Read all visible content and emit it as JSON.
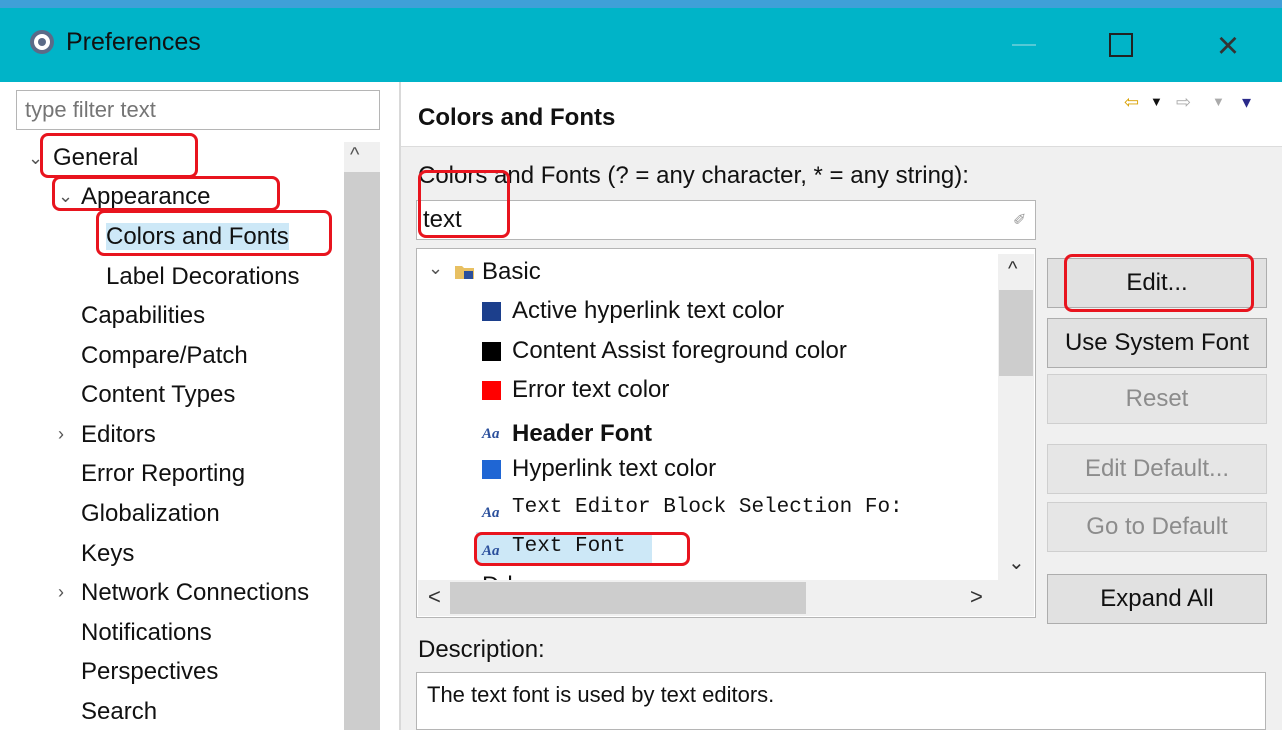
{
  "window": {
    "title": "Preferences",
    "minimize_glyph": "—",
    "maximize_glyph": "",
    "close_glyph": "×",
    "icon": "gear-icon"
  },
  "left": {
    "filter_placeholder": "type filter text",
    "tree": [
      {
        "label": "General",
        "twisty": "⌄"
      },
      {
        "label": "Appearance",
        "twisty": "⌄"
      },
      {
        "label": "Colors and Fonts",
        "selected": true
      },
      {
        "label": "Label Decorations"
      },
      {
        "label": "Capabilities"
      },
      {
        "label": "Compare/Patch"
      },
      {
        "label": "Content Types"
      },
      {
        "label": "Editors",
        "twisty": "›"
      },
      {
        "label": "Error Reporting"
      },
      {
        "label": "Globalization"
      },
      {
        "label": "Keys"
      },
      {
        "label": "Network Connections",
        "twisty": "›"
      },
      {
        "label": "Notifications"
      },
      {
        "label": "Perspectives"
      },
      {
        "label": "Search"
      }
    ],
    "scroll_up_glyph": "^"
  },
  "right": {
    "title": "Colors and Fonts",
    "nav": {
      "back": "⇦",
      "back_menu": "▼",
      "forward": "⇨",
      "forward_menu": "▼",
      "view_menu": "▾"
    },
    "filter_label": "Colors and Fonts (? = any character, * = any string):",
    "filter_value": "text",
    "clear_icon": "eraser-icon",
    "tree": {
      "category": {
        "label": "Basic",
        "twisty": "⌄"
      },
      "items": [
        {
          "label": "Active hyperlink text color",
          "kind": "color",
          "color": "#1c3f8c"
        },
        {
          "label": "Content Assist foreground color",
          "kind": "color",
          "color": "#000000"
        },
        {
          "label": "Error text color",
          "kind": "color",
          "color": "#ff0000"
        },
        {
          "label": "Header Font",
          "kind": "font",
          "bold": true
        },
        {
          "label": "Hyperlink text color",
          "kind": "color",
          "color": "#1f66d4"
        },
        {
          "label": "Text Editor Block Selection Fo:",
          "kind": "font",
          "mono": true
        },
        {
          "label": "Text Font",
          "kind": "font",
          "mono": true,
          "selected": true
        }
      ],
      "next_category_partial": "D-l",
      "font_glyph": "Aa",
      "scroll_up": "^",
      "scroll_down": "⌄",
      "scroll_left": "<",
      "scroll_right": ">"
    },
    "buttons": {
      "edit": "Edit...",
      "use_system_font": "Use System Font",
      "reset": "Reset",
      "edit_default": "Edit Default...",
      "go_to_default": "Go to Default",
      "expand_all": "Expand All"
    },
    "description_label": "Description:",
    "description_text": "The text font is used by text editors."
  },
  "colors": {
    "titlebar": "#00b4c8",
    "annotation": "#e8141e",
    "selection": "#cde8f7"
  }
}
